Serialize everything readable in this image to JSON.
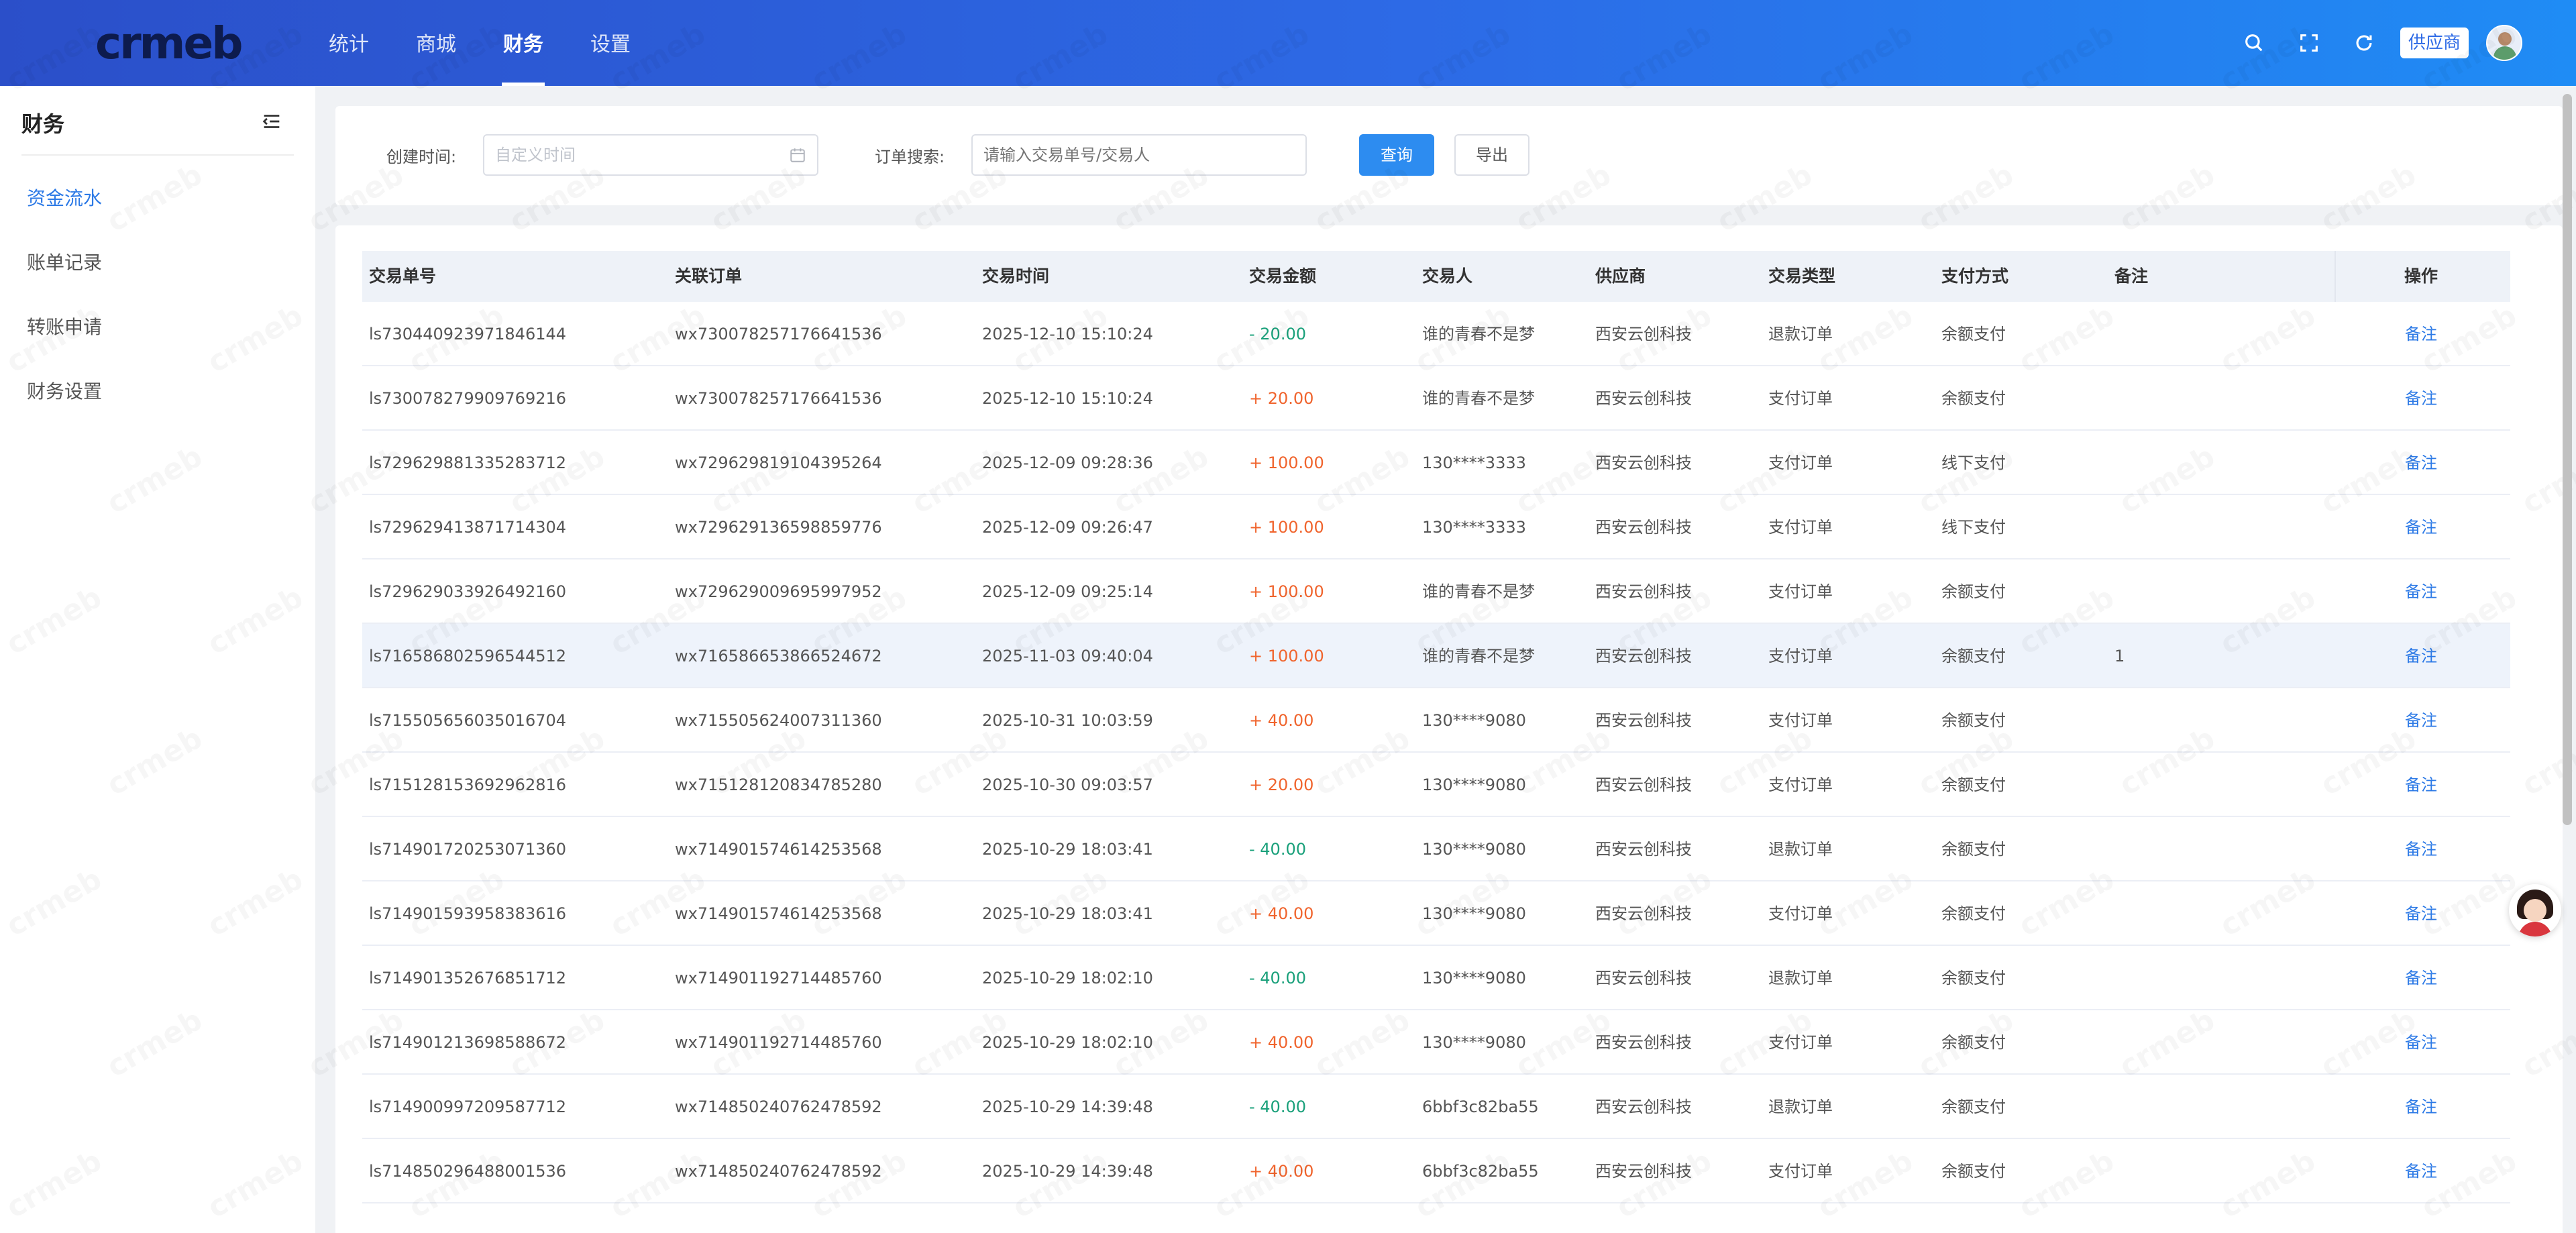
{
  "header": {
    "logo_text": "crmeb",
    "nav": [
      {
        "label": "统计"
      },
      {
        "label": "商城"
      },
      {
        "label": "财务"
      },
      {
        "label": "设置"
      }
    ],
    "active_nav": "财务",
    "role_tag": "供应商",
    "icons": [
      "search-icon",
      "fullscreen-icon",
      "refresh-icon"
    ]
  },
  "sidebar": {
    "title": "财务",
    "items": [
      {
        "label": "资金流水"
      },
      {
        "label": "账单记录"
      },
      {
        "label": "转账申请"
      },
      {
        "label": "财务设置"
      }
    ],
    "active_item": "资金流水"
  },
  "filter": {
    "created_time_label": "创建时间:",
    "created_time_placeholder": "自定义时间",
    "order_search_label": "订单搜索:",
    "order_search_placeholder": "请输入交易单号/交易人",
    "query_button": "查询",
    "export_button": "导出"
  },
  "table": {
    "columns": [
      "交易单号",
      "关联订单",
      "交易时间",
      "交易金额",
      "交易人",
      "供应商",
      "交易类型",
      "支付方式",
      "备注",
      "操作"
    ],
    "rows": [
      {
        "id": "ls730440923971846144",
        "order": "wx730078257176641536",
        "time": "2025-12-10 15:10:24",
        "amount": "- 20.00",
        "sign": "neg",
        "user": "谁的青春不是梦",
        "supplier": "西安云创科技",
        "type": "退款订单",
        "pay": "余额支付",
        "remark": "",
        "op": "备注"
      },
      {
        "id": "ls730078279909769216",
        "order": "wx730078257176641536",
        "time": "2025-12-10 15:10:24",
        "amount": "+ 20.00",
        "sign": "pos",
        "user": "谁的青春不是梦",
        "supplier": "西安云创科技",
        "type": "支付订单",
        "pay": "余额支付",
        "remark": "",
        "op": "备注"
      },
      {
        "id": "ls729629881335283712",
        "order": "wx729629819104395264",
        "time": "2025-12-09 09:28:36",
        "amount": "+ 100.00",
        "sign": "pos",
        "user": "130****3333",
        "supplier": "西安云创科技",
        "type": "支付订单",
        "pay": "线下支付",
        "remark": "",
        "op": "备注"
      },
      {
        "id": "ls729629413871714304",
        "order": "wx729629136598859776",
        "time": "2025-12-09 09:26:47",
        "amount": "+ 100.00",
        "sign": "pos",
        "user": "130****3333",
        "supplier": "西安云创科技",
        "type": "支付订单",
        "pay": "线下支付",
        "remark": "",
        "op": "备注"
      },
      {
        "id": "ls729629033926492160",
        "order": "wx729629009695997952",
        "time": "2025-12-09 09:25:14",
        "amount": "+ 100.00",
        "sign": "pos",
        "user": "谁的青春不是梦",
        "supplier": "西安云创科技",
        "type": "支付订单",
        "pay": "余额支付",
        "remark": "",
        "op": "备注"
      },
      {
        "id": "ls716586802596544512",
        "order": "wx716586653866524672",
        "time": "2025-11-03 09:40:04",
        "amount": "+ 100.00",
        "sign": "pos",
        "user": "谁的青春不是梦",
        "supplier": "西安云创科技",
        "type": "支付订单",
        "pay": "余额支付",
        "remark": "1",
        "op": "备注",
        "highlight": true
      },
      {
        "id": "ls715505656035016704",
        "order": "wx715505624007311360",
        "time": "2025-10-31 10:03:59",
        "amount": "+ 40.00",
        "sign": "pos",
        "user": "130****9080",
        "supplier": "西安云创科技",
        "type": "支付订单",
        "pay": "余额支付",
        "remark": "",
        "op": "备注"
      },
      {
        "id": "ls715128153692962816",
        "order": "wx715128120834785280",
        "time": "2025-10-30 09:03:57",
        "amount": "+ 20.00",
        "sign": "pos",
        "user": "130****9080",
        "supplier": "西安云创科技",
        "type": "支付订单",
        "pay": "余额支付",
        "remark": "",
        "op": "备注"
      },
      {
        "id": "ls714901720253071360",
        "order": "wx714901574614253568",
        "time": "2025-10-29 18:03:41",
        "amount": "- 40.00",
        "sign": "neg",
        "user": "130****9080",
        "supplier": "西安云创科技",
        "type": "退款订单",
        "pay": "余额支付",
        "remark": "",
        "op": "备注"
      },
      {
        "id": "ls714901593958383616",
        "order": "wx714901574614253568",
        "time": "2025-10-29 18:03:41",
        "amount": "+ 40.00",
        "sign": "pos",
        "user": "130****9080",
        "supplier": "西安云创科技",
        "type": "支付订单",
        "pay": "余额支付",
        "remark": "",
        "op": "备注"
      },
      {
        "id": "ls714901352676851712",
        "order": "wx714901192714485760",
        "time": "2025-10-29 18:02:10",
        "amount": "- 40.00",
        "sign": "neg",
        "user": "130****9080",
        "supplier": "西安云创科技",
        "type": "退款订单",
        "pay": "余额支付",
        "remark": "",
        "op": "备注"
      },
      {
        "id": "ls714901213698588672",
        "order": "wx714901192714485760",
        "time": "2025-10-29 18:02:10",
        "amount": "+ 40.00",
        "sign": "pos",
        "user": "130****9080",
        "supplier": "西安云创科技",
        "type": "支付订单",
        "pay": "余额支付",
        "remark": "",
        "op": "备注"
      },
      {
        "id": "ls714900997209587712",
        "order": "wx714850240762478592",
        "time": "2025-10-29 14:39:48",
        "amount": "- 40.00",
        "sign": "neg",
        "user": "6bbf3c82ba55",
        "supplier": "西安云创科技",
        "type": "退款订单",
        "pay": "余额支付",
        "remark": "",
        "op": "备注"
      },
      {
        "id": "ls714850296488001536",
        "order": "wx714850240762478592",
        "time": "2025-10-29 14:39:48",
        "amount": "+ 40.00",
        "sign": "pos",
        "user": "6bbf3c82ba55",
        "supplier": "西安云创科技",
        "type": "支付订单",
        "pay": "余额支付",
        "remark": "",
        "op": "备注"
      }
    ]
  },
  "watermark": "crmeb"
}
